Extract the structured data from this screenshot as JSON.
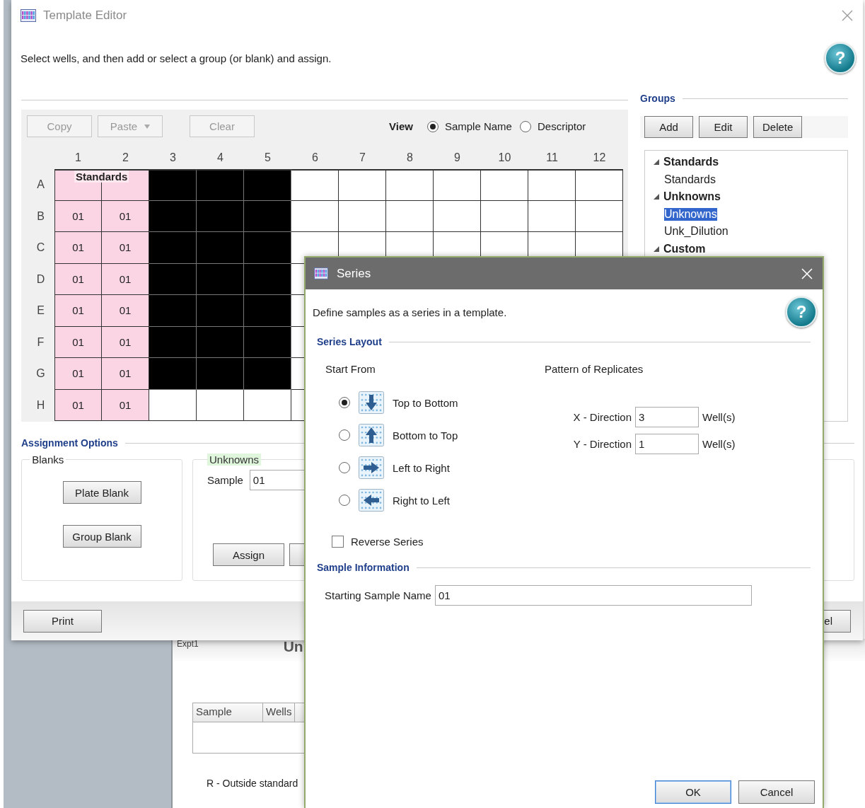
{
  "background": {
    "tab": "Expt1",
    "heading": "Un",
    "table": {
      "columns": [
        "Sample",
        "Wells"
      ]
    },
    "note": "R - Outside standard"
  },
  "editor": {
    "title": "Template Editor",
    "instruction": "Select wells, and then add or select a group (or blank) and assign.",
    "help": "?",
    "toolbar": [
      {
        "label": "Copy",
        "dropdown": false
      },
      {
        "label": "Paste",
        "dropdown": true
      },
      {
        "label": "Clear",
        "dropdown": false
      }
    ],
    "view": {
      "label": "View",
      "options": [
        {
          "label": "Sample Name",
          "selected": true
        },
        {
          "label": "Descriptor",
          "selected": false
        }
      ]
    },
    "plate": {
      "group_label": "Standards",
      "columns": [
        "1",
        "2",
        "3",
        "4",
        "5",
        "6",
        "7",
        "8",
        "9",
        "10",
        "11",
        "12"
      ],
      "rows": [
        {
          "label": "A",
          "wells": [
            {
              "kind": "standard"
            },
            {
              "kind": "standard"
            },
            {
              "kind": "selected"
            },
            {
              "kind": "selected"
            },
            {
              "kind": "selected"
            },
            {
              "kind": "empty"
            },
            {
              "kind": "empty"
            },
            {
              "kind": "empty"
            },
            {
              "kind": "empty"
            },
            {
              "kind": "empty"
            },
            {
              "kind": "empty"
            },
            {
              "kind": "empty"
            }
          ]
        },
        {
          "label": "B",
          "wells": [
            {
              "kind": "standard",
              "text": "01"
            },
            {
              "kind": "standard",
              "text": "01"
            },
            {
              "kind": "selected"
            },
            {
              "kind": "selected"
            },
            {
              "kind": "selected"
            },
            {
              "kind": "empty"
            },
            {
              "kind": "empty"
            },
            {
              "kind": "empty"
            },
            {
              "kind": "empty"
            },
            {
              "kind": "empty"
            },
            {
              "kind": "empty"
            },
            {
              "kind": "empty"
            }
          ]
        },
        {
          "label": "C",
          "wells": [
            {
              "kind": "standard",
              "text": "01"
            },
            {
              "kind": "standard",
              "text": "01"
            },
            {
              "kind": "selected"
            },
            {
              "kind": "selected"
            },
            {
              "kind": "selected"
            },
            {
              "kind": "empty"
            },
            {
              "kind": "empty"
            },
            {
              "kind": "empty"
            },
            {
              "kind": "empty"
            },
            {
              "kind": "empty"
            },
            {
              "kind": "empty"
            },
            {
              "kind": "empty"
            }
          ]
        },
        {
          "label": "D",
          "wells": [
            {
              "kind": "standard",
              "text": "01"
            },
            {
              "kind": "standard",
              "text": "01"
            },
            {
              "kind": "selected"
            },
            {
              "kind": "selected"
            },
            {
              "kind": "selected"
            },
            {
              "kind": "empty"
            }
          ]
        },
        {
          "label": "E",
          "wells": [
            {
              "kind": "standard",
              "text": "01"
            },
            {
              "kind": "standard",
              "text": "01"
            },
            {
              "kind": "selected"
            },
            {
              "kind": "selected"
            },
            {
              "kind": "selected"
            },
            {
              "kind": "empty"
            }
          ]
        },
        {
          "label": "F",
          "wells": [
            {
              "kind": "standard",
              "text": "01"
            },
            {
              "kind": "standard",
              "text": "01"
            },
            {
              "kind": "selected"
            },
            {
              "kind": "selected"
            },
            {
              "kind": "selected"
            },
            {
              "kind": "empty"
            }
          ]
        },
        {
          "label": "G",
          "wells": [
            {
              "kind": "standard",
              "text": "01"
            },
            {
              "kind": "standard",
              "text": "01"
            },
            {
              "kind": "selected"
            },
            {
              "kind": "selected"
            },
            {
              "kind": "selected"
            },
            {
              "kind": "empty"
            }
          ]
        },
        {
          "label": "H",
          "wells": [
            {
              "kind": "standard",
              "text": "01"
            },
            {
              "kind": "standard",
              "text": "01"
            },
            {
              "kind": "empty"
            },
            {
              "kind": "empty"
            },
            {
              "kind": "empty"
            },
            {
              "kind": "empty"
            }
          ]
        }
      ]
    },
    "groups": {
      "title": "Groups",
      "buttons": [
        "Add",
        "Edit",
        "Delete"
      ],
      "tree": [
        {
          "label": "Standards",
          "expanded": true,
          "children": [
            {
              "label": "Standards",
              "selected": false
            }
          ]
        },
        {
          "label": "Unknowns",
          "expanded": true,
          "children": [
            {
              "label": "Unknowns",
              "selected": true
            },
            {
              "label": "Unk_Dilution",
              "selected": false
            }
          ]
        },
        {
          "label": "Custom",
          "expanded": true
        }
      ]
    },
    "assignment": {
      "title": "Assignment Options",
      "blanks": {
        "title": "Blanks",
        "buttons": [
          "Plate Blank",
          "Group Blank"
        ]
      },
      "unknowns": {
        "title": "Unknowns",
        "sample_label": "Sample",
        "sample_value": "01",
        "buttons": [
          "Assign"
        ]
      }
    },
    "footer": {
      "print": "Print",
      "cancel_partial": "el"
    }
  },
  "dialog": {
    "title": "Series",
    "description": "Define samples as a series in a template.",
    "help": "?",
    "layout_section": "Series Layout",
    "start_from": {
      "label": "Start From",
      "options": [
        {
          "label": "Top to Bottom",
          "kind": "down",
          "selected": true
        },
        {
          "label": "Bottom to Top",
          "kind": "up",
          "selected": false
        },
        {
          "label": "Left to Right",
          "kind": "right",
          "selected": false
        },
        {
          "label": "Right to Left",
          "kind": "left",
          "selected": false
        }
      ]
    },
    "replicates": {
      "label": "Pattern of Replicates",
      "fields": [
        {
          "label": "X - Direction",
          "value": "3",
          "unit": "Well(s)"
        },
        {
          "label": "Y - Direction",
          "value": "1",
          "unit": "Well(s)"
        }
      ]
    },
    "reverse": {
      "label": "Reverse Series",
      "checked": false
    },
    "sample_section": "Sample Information",
    "starting_name": {
      "label": "Starting Sample Name",
      "value": "01"
    },
    "buttons": [
      {
        "label": "OK",
        "default": true
      },
      {
        "label": "Cancel",
        "default": false
      }
    ]
  }
}
